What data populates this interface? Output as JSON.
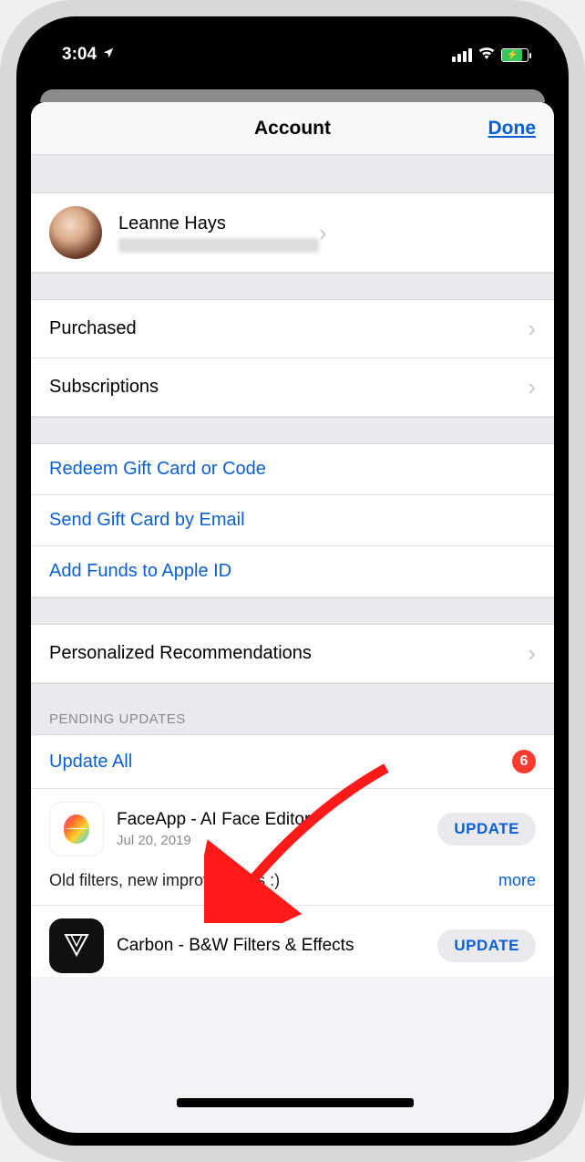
{
  "status": {
    "time": "3:04",
    "location_icon": "location-arrow"
  },
  "nav": {
    "title": "Account",
    "done": "Done"
  },
  "profile": {
    "name": "Leanne Hays"
  },
  "rows": {
    "purchased": "Purchased",
    "subscriptions": "Subscriptions",
    "redeem": "Redeem Gift Card or Code",
    "send_gift": "Send Gift Card by Email",
    "add_funds": "Add Funds to Apple ID",
    "personalized": "Personalized Recommendations"
  },
  "updates": {
    "header": "PENDING UPDATES",
    "update_all": "Update All",
    "badge": "6",
    "update_btn": "UPDATE",
    "more": "more",
    "apps": [
      {
        "name": "FaceApp - AI Face Editor",
        "date": "Jul 20, 2019",
        "desc": "Old filters, new improvements :)"
      },
      {
        "name": "Carbon - B&W Filters & Effects"
      }
    ]
  }
}
